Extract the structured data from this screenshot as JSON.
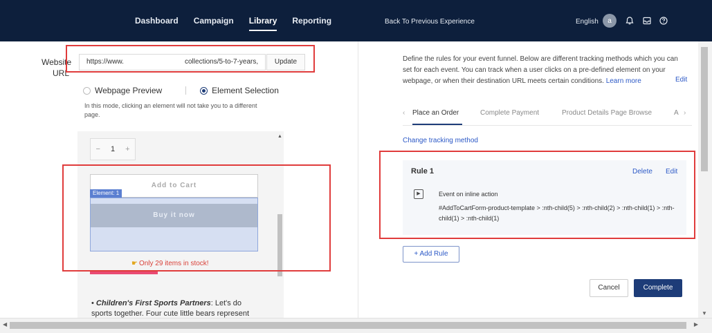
{
  "topbar": {
    "nav": [
      {
        "label": "Dashboard"
      },
      {
        "label": "Campaign"
      },
      {
        "label": "Library"
      },
      {
        "label": "Reporting"
      }
    ],
    "back_link": "Back To Previous Experience",
    "language": "English",
    "avatar_initial": "a",
    "icons": [
      "bell-icon",
      "inbox-icon",
      "help-icon"
    ]
  },
  "left": {
    "website_label": "Website URL",
    "url_value_start": "https://www.",
    "url_value_end": "collections/5-to-7-years,",
    "update_label": "Update",
    "radio_preview": "Webpage Preview",
    "radio_selection": "Element Selection",
    "selected_mode": "Element Selection",
    "hint": "In this mode, clicking an element will not take you to a different page.",
    "preview": {
      "stepper_minus": "−",
      "stepper_qty": "1",
      "stepper_plus": "+",
      "add_to_cart": "Add to Cart",
      "element_tag": "Element: 1",
      "buy_now": "Buy it now",
      "stock": "Only 29 items in stock!",
      "bullet_bold": "Children's First Sports Partners",
      "bullet_text": ":  Let's do sports together. Four cute little bears represent"
    }
  },
  "right": {
    "description": "Define the rules for your event funnel. Below are different tracking methods which you can set for each event. You can track when a user clicks on a pre-defined element on your webpage, or when their destination URL meets certain conditions.",
    "learn_more": "Learn more",
    "edit": "Edit",
    "tabs": [
      {
        "label": "Place an Order"
      },
      {
        "label": "Complete Payment"
      },
      {
        "label": "Product Details Page Browse"
      },
      {
        "label": "A"
      }
    ],
    "change_method": "Change tracking method",
    "rule": {
      "title": "Rule 1",
      "delete": "Delete",
      "edit": "Edit",
      "event": "Event on inline action",
      "selector": "#AddToCartForm-product-template > :nth-child(5) > :nth-child(2) > :nth-child(1) > :nth-child(1) > :nth-child(1)"
    },
    "add_rule": "+ Add Rule",
    "cancel": "Cancel",
    "complete": "Complete"
  },
  "colors": {
    "topbar": "#0d1f3c",
    "primary": "#1d3c78",
    "link": "#2b58c6",
    "highlight": "#e03b3b"
  }
}
